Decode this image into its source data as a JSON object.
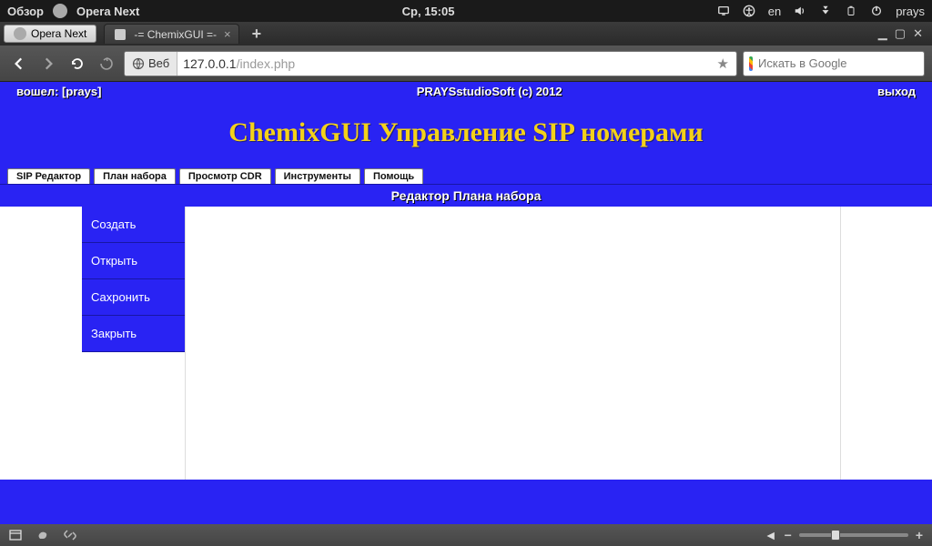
{
  "system": {
    "overview": "Обзор",
    "app": "Opera Next",
    "clock": "Ср, 15:05",
    "lang": "en",
    "user": "prays"
  },
  "taskbar": {
    "task_app": "Opera Next",
    "tab_title": "-= ChemixGUI =-",
    "new_tab": "+"
  },
  "browser": {
    "badge": "Веб",
    "url_host": "127.0.0.1",
    "url_path": "/index.php",
    "search_placeholder": "Искать в Google"
  },
  "app": {
    "login_prefix": "вошел:",
    "login_user": "[prays]",
    "copyright": "PRAYSstudioSoft (c) 2012",
    "logout": "выход",
    "title": "ChemixGUI Управление SIP номерами",
    "tabs": [
      "SIP Редактор",
      "План набора",
      "Просмотр CDR",
      "Инструменты",
      "Помощь"
    ],
    "section": "Редактор Плана набора",
    "menu": [
      "Создать",
      "Открыть",
      "Сахронить",
      "Закрыть"
    ]
  }
}
